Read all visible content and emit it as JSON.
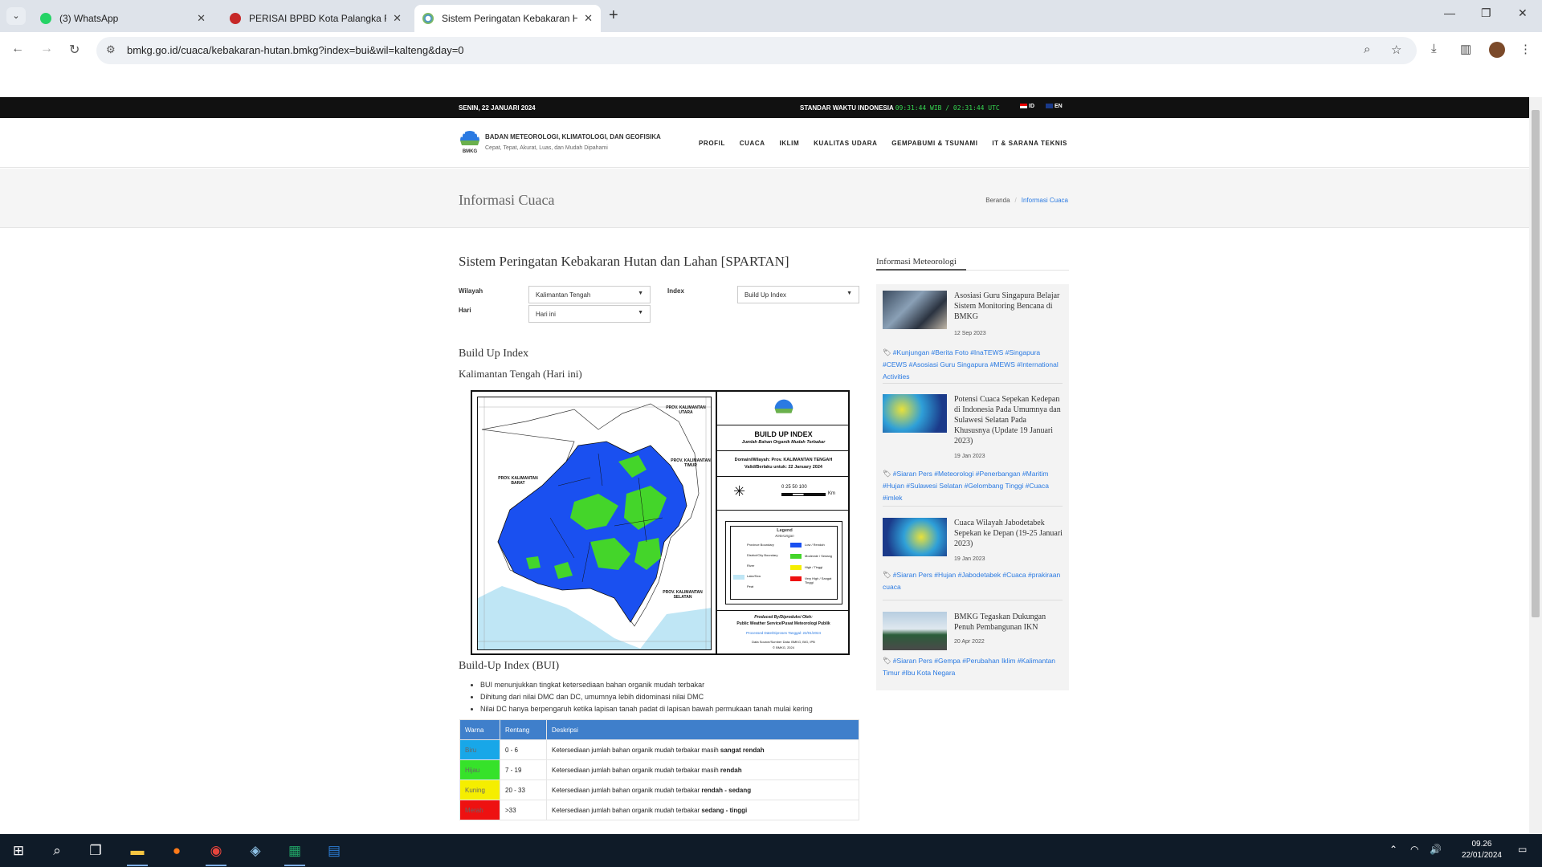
{
  "browser": {
    "tabs": [
      {
        "label": "(3) WhatsApp",
        "icon": "whatsapp-icon",
        "color": "#25d366"
      },
      {
        "label": "PERISAI BPBD Kota Palangka Ra",
        "icon": "bpbd-logo-icon",
        "color": "#c62828"
      },
      {
        "label": "Sistem Peringatan Kebakaran H",
        "icon": "bmkg-logo-icon",
        "color": "#3f8fd8"
      }
    ],
    "url": "bmkg.go.id/cuaca/kebakaran-hutan.bmkg?index=bui&wil=kalteng&day=0"
  },
  "site": {
    "topbar": {
      "date": "SENIN, 22 JANUARI 2024",
      "time_label": "STANDAR WAKTU INDONESIA",
      "time_value": "09:31:44 WIB / 02:31:44 UTC",
      "lang_id": "ID",
      "lang_en": "EN"
    },
    "brand": {
      "name": "BADAN METEOROLOGI, KLIMATOLOGI, DAN GEOFISIKA",
      "tagline": "Cepat, Tepat, Akurat, Luas, dan Mudah Dipahami",
      "logo_text": "BMKG"
    },
    "nav": [
      "PROFIL",
      "CUACA",
      "IKLIM",
      "KUALITAS UDARA",
      "GEMPABUMI & TSUNAMI",
      "IT & SARANA TEKNIS"
    ],
    "page_heading": "Informasi Cuaca",
    "breadcrumb": {
      "home": "Beranda",
      "current": "Informasi Cuaca"
    }
  },
  "main": {
    "title": "Sistem Peringatan Kebakaran Hutan dan Lahan [SPARTAN]",
    "filters": {
      "wilayah_label": "Wilayah",
      "wilayah_value": "Kalimantan Tengah",
      "index_label": "Index",
      "index_value": "Build Up Index",
      "hari_label": "Hari",
      "hari_value": "Hari ini"
    },
    "section_title": "Build Up Index",
    "section_subtitle": "Kalimantan Tengah (Hari ini)",
    "map": {
      "title": "BUILD UP INDEX",
      "subtitle": "Jumlah Bahan Organik Mudah Terbakar",
      "domain": "Domain/Wilayah: Prov. KALIMANTAN TENGAH",
      "valid": "Valid/Berlaku untuk: 22 January 2024",
      "scale": "0  25 50    100",
      "scale_unit": "Km",
      "legend_title": "Legend",
      "legend_subtitle": "Keterangan",
      "legend_left": [
        "Province Boundary",
        "District/City Boundary",
        "River",
        "Lake/Sea",
        "Peat"
      ],
      "legend_right": [
        "Low / Rendah",
        "Moderate / Sedang",
        "High / Tinggi",
        "Very High / Sangat Tinggi"
      ],
      "produced_by": "Produced By/Diproduksi Oleh:",
      "produced_org": "Public Weather Service/Pusat Meteorologi Publik",
      "processed": "Processed Date/Diproses Tanggal: 22/01/2024",
      "source": "Data Source/Sumber Data: BMKG, BIG, IPB",
      "copyright": "© BMKG, 2024",
      "labels": {
        "barat": "PROV. KALIMANTAN BARAT",
        "timur": "PROV. KALIMANTAN TIMUR",
        "utara": "PROV. KALIMANTAN UTARA",
        "selatan": "PROV. KALIMANTAN SELATAN"
      }
    },
    "bui_title": "Build-Up Index (BUI)",
    "bui_points": [
      "BUI menunjukkan tingkat ketersediaan bahan organik mudah terbakar",
      "Dihitung dari nilai DMC dan DC, umumnya lebih didominasi nilai DMC",
      "Nilai DC hanya berpengaruh ketika lapisan tanah padat di lapisan bawah permukaan tanah mulai kering"
    ],
    "table": {
      "headers": [
        "Warna",
        "Rentang",
        "Deskripsi"
      ],
      "rows": [
        {
          "warna": "Biru",
          "color": "#18a7e8",
          "rentang": "0 - 6",
          "desc": "Ketersediaan jumlah bahan organik mudah terbakar masih ",
          "bold": "sangat rendah"
        },
        {
          "warna": "Hijau",
          "color": "#36e22a",
          "rentang": "7 - 19",
          "desc": "Ketersediaan jumlah bahan organik mudah terbakar masih ",
          "bold": "rendah"
        },
        {
          "warna": "Kuning",
          "color": "#f5ee00",
          "rentang": "20 - 33",
          "desc": "Ketersediaan jumlah bahan organik mudah terbakar ",
          "bold": "rendah - sedang"
        },
        {
          "warna": "Merah",
          "color": "#ee1111",
          "rentang": ">33",
          "desc": "Ketersediaan jumlah bahan organik mudah terbakar ",
          "bold": "sedang - tinggi"
        }
      ]
    }
  },
  "sidebar": {
    "title": "Informasi Meteorologi",
    "news": [
      {
        "title": "Asosiasi Guru Singapura Belajar Sistem Monitoring Bencana di BMKG",
        "date": "12 Sep 2023",
        "tags": "#Kunjungan #Berita Foto #InaTEWS #Singapura #CEWS #Asosiasi Guru Singapura #MEWS #International Activities"
      },
      {
        "title": "Potensi Cuaca Sepekan Kedepan di Indonesia Pada Umumnya dan Sulawesi Selatan Pada Khususnya (Update 19 Januari 2023)",
        "date": "19 Jan 2023",
        "tags": "#Siaran Pers #Meteorologi #Penerbangan #Maritim #Hujan #Sulawesi Selatan #Gelombang Tinggi #Cuaca #imlek"
      },
      {
        "title": "Cuaca Wilayah Jabodetabek Sepekan ke Depan (19-25 Januari 2023)",
        "date": "19 Jan 2023",
        "tags": "#Siaran Pers #Hujan #Jabodetabek #Cuaca #prakiraan cuaca"
      },
      {
        "title": "BMKG Tegaskan Dukungan Penuh Pembangunan IKN",
        "date": "20 Apr 2022",
        "tags": "#Siaran Pers #Gempa #Perubahan Iklim #Kalimantan Timur #Ibu Kota Negara"
      }
    ]
  },
  "taskbar": {
    "time": "09.26",
    "date": "22/01/2024"
  }
}
